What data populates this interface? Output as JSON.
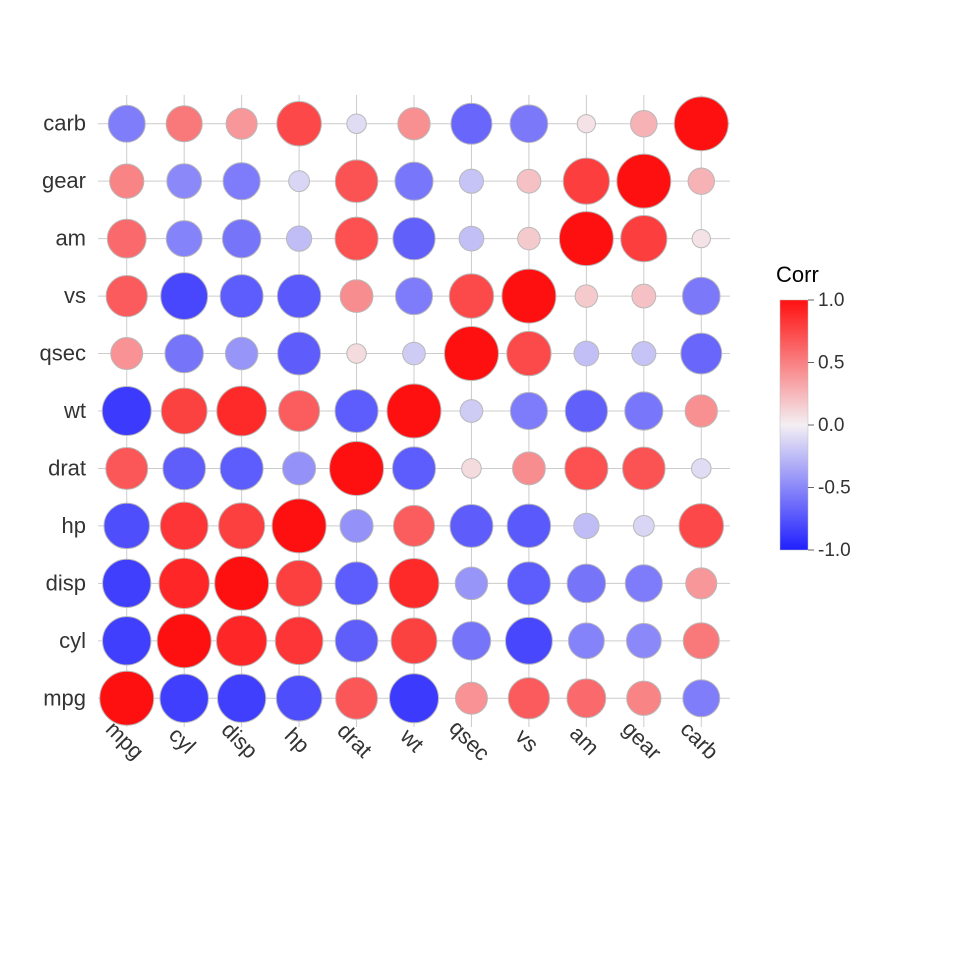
{
  "legend": {
    "title": "Corr",
    "ticks": [
      "1.0",
      "0.5",
      "0.0",
      "-0.5",
      "-1.0"
    ],
    "tick_values": [
      1.0,
      0.5,
      0.0,
      -0.5,
      -1.0
    ]
  },
  "chart_data": {
    "type": "heatmap",
    "title": "",
    "xlabel": "",
    "ylabel": "",
    "variables": [
      "mpg",
      "cyl",
      "disp",
      "hp",
      "drat",
      "wt",
      "qsec",
      "vs",
      "am",
      "gear",
      "carb"
    ],
    "x_order": [
      "mpg",
      "cyl",
      "disp",
      "hp",
      "drat",
      "wt",
      "qsec",
      "vs",
      "am",
      "gear",
      "carb"
    ],
    "y_order_bottom_to_top": [
      "mpg",
      "cyl",
      "disp",
      "hp",
      "drat",
      "wt",
      "qsec",
      "vs",
      "am",
      "gear",
      "carb"
    ],
    "color_scale": {
      "min": -1.0,
      "max": 1.0,
      "low": "#2020FF",
      "mid": "#F3EFF3",
      "high": "#FF1010"
    },
    "size_encodes": "abs(correlation)",
    "matrix": {
      "mpg": {
        "mpg": 1.0,
        "cyl": -0.852,
        "disp": -0.848,
        "hp": -0.776,
        "drat": 0.681,
        "wt": -0.868,
        "qsec": 0.419,
        "vs": 0.664,
        "am": 0.6,
        "gear": 0.48,
        "carb": -0.551
      },
      "cyl": {
        "mpg": -0.852,
        "cyl": 1.0,
        "disp": 0.902,
        "hp": 0.832,
        "drat": -0.7,
        "wt": 0.782,
        "qsec": -0.591,
        "vs": -0.811,
        "am": -0.523,
        "gear": -0.493,
        "carb": 0.527
      },
      "disp": {
        "mpg": -0.848,
        "cyl": 0.902,
        "disp": 1.0,
        "hp": 0.791,
        "drat": -0.71,
        "wt": 0.888,
        "qsec": -0.434,
        "vs": -0.71,
        "am": -0.591,
        "gear": -0.556,
        "carb": 0.395
      },
      "hp": {
        "mpg": -0.776,
        "cyl": 0.832,
        "disp": 0.791,
        "hp": 1.0,
        "drat": -0.449,
        "wt": 0.659,
        "qsec": -0.708,
        "vs": -0.723,
        "am": -0.243,
        "gear": -0.126,
        "carb": 0.75
      },
      "drat": {
        "mpg": 0.681,
        "cyl": -0.7,
        "disp": -0.71,
        "hp": -0.449,
        "drat": 1.0,
        "wt": -0.712,
        "qsec": 0.091,
        "vs": 0.44,
        "am": 0.713,
        "gear": 0.7,
        "carb": -0.091
      },
      "wt": {
        "mpg": -0.868,
        "cyl": 0.782,
        "disp": 0.888,
        "hp": 0.659,
        "drat": -0.712,
        "wt": 1.0,
        "qsec": -0.175,
        "vs": -0.555,
        "am": -0.692,
        "gear": -0.583,
        "carb": 0.428
      },
      "qsec": {
        "mpg": 0.419,
        "cyl": -0.591,
        "disp": -0.434,
        "hp": -0.708,
        "drat": 0.091,
        "wt": -0.175,
        "qsec": 1.0,
        "vs": 0.745,
        "am": -0.23,
        "gear": -0.213,
        "carb": -0.656
      },
      "vs": {
        "mpg": 0.664,
        "cyl": -0.811,
        "disp": -0.71,
        "hp": -0.723,
        "drat": 0.44,
        "wt": -0.555,
        "qsec": 0.745,
        "vs": 1.0,
        "am": 0.168,
        "gear": 0.206,
        "carb": -0.57
      },
      "am": {
        "mpg": 0.6,
        "cyl": -0.523,
        "disp": -0.591,
        "hp": -0.243,
        "drat": 0.713,
        "wt": -0.692,
        "qsec": -0.23,
        "vs": 0.168,
        "am": 1.0,
        "gear": 0.794,
        "carb": 0.058
      },
      "gear": {
        "mpg": 0.48,
        "cyl": -0.493,
        "disp": -0.556,
        "hp": -0.126,
        "drat": 0.7,
        "wt": -0.583,
        "qsec": -0.213,
        "vs": 0.206,
        "am": 0.794,
        "gear": 1.0,
        "carb": 0.274
      },
      "carb": {
        "mpg": -0.551,
        "cyl": 0.527,
        "disp": 0.395,
        "hp": 0.75,
        "drat": -0.091,
        "wt": 0.428,
        "qsec": -0.656,
        "vs": -0.57,
        "am": 0.058,
        "gear": 0.274,
        "carb": 1.0
      }
    }
  }
}
